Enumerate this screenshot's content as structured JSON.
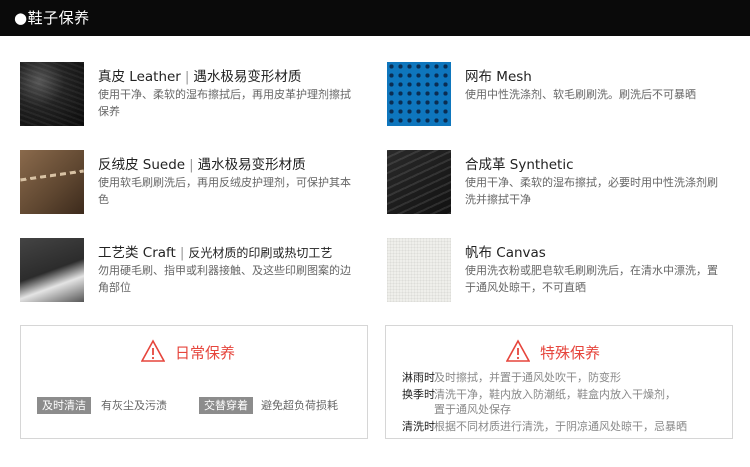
{
  "header": {
    "title": "●鞋子保养"
  },
  "materials": [
    {
      "name": "真皮 Leather",
      "note": "遇水极易变形材质",
      "desc": "使用干净、柔软的湿布擦拭后，再用皮革护理剂擦拭保养",
      "icon": "leather-swatch"
    },
    {
      "name": "网布 Mesh",
      "note": "",
      "desc": "使用中性洗涤剂、软毛刷刷洗。刷洗后不可暴晒",
      "icon": "mesh-swatch"
    },
    {
      "name": "反绒皮 Suede",
      "note": "遇水极易变形材质",
      "desc": "使用软毛刷刷洗后，再用反绒皮护理剂，可保护其本色",
      "icon": "suede-swatch"
    },
    {
      "name": "合成革 Synthetic",
      "note": "",
      "desc": "使用干净、柔软的湿布擦拭，必要时用中性洗涤剂刷洗并擦拭干净",
      "icon": "synthetic-swatch"
    },
    {
      "name": "工艺类 Craft",
      "note": "反光材质的印刷或热切工艺",
      "desc": "勿用硬毛刷、指甲或利器接触、及这些印刷图案的边角部位",
      "icon": "craft-swatch"
    },
    {
      "name": "帆布 Canvas",
      "note": "",
      "desc": "使用洗衣粉或肥皂软毛刷刷洗后，在清水中漂洗，置于通风处晾干，不可直晒",
      "icon": "canvas-swatch"
    }
  ],
  "daily": {
    "title": "日常保养",
    "icon": "warning-triangle-icon",
    "tags": [
      {
        "label": "及时清洁",
        "text": "有灰尘及污渍"
      },
      {
        "label": "交替穿着",
        "text": "避免超负荷损耗"
      }
    ]
  },
  "special": {
    "title": "特殊保养",
    "icon": "warning-triangle-icon",
    "rules": [
      {
        "label": "淋雨时",
        "lines": [
          "及时擦拭，并置于通风处吹干，防变形"
        ]
      },
      {
        "label": "换季时",
        "lines": [
          "清洗干净，鞋内放入防潮纸，鞋盒内放入干燥剂，",
          "置于通风处保存"
        ]
      },
      {
        "label": "清洗时",
        "lines": [
          "根据不同材质进行清洗，于阴凉通风处晾干，忌暴晒"
        ]
      }
    ]
  },
  "colors": {
    "accent": "#e6453c",
    "header_bg": "#0a0a0a",
    "tag_bg": "#8c8c8c"
  }
}
